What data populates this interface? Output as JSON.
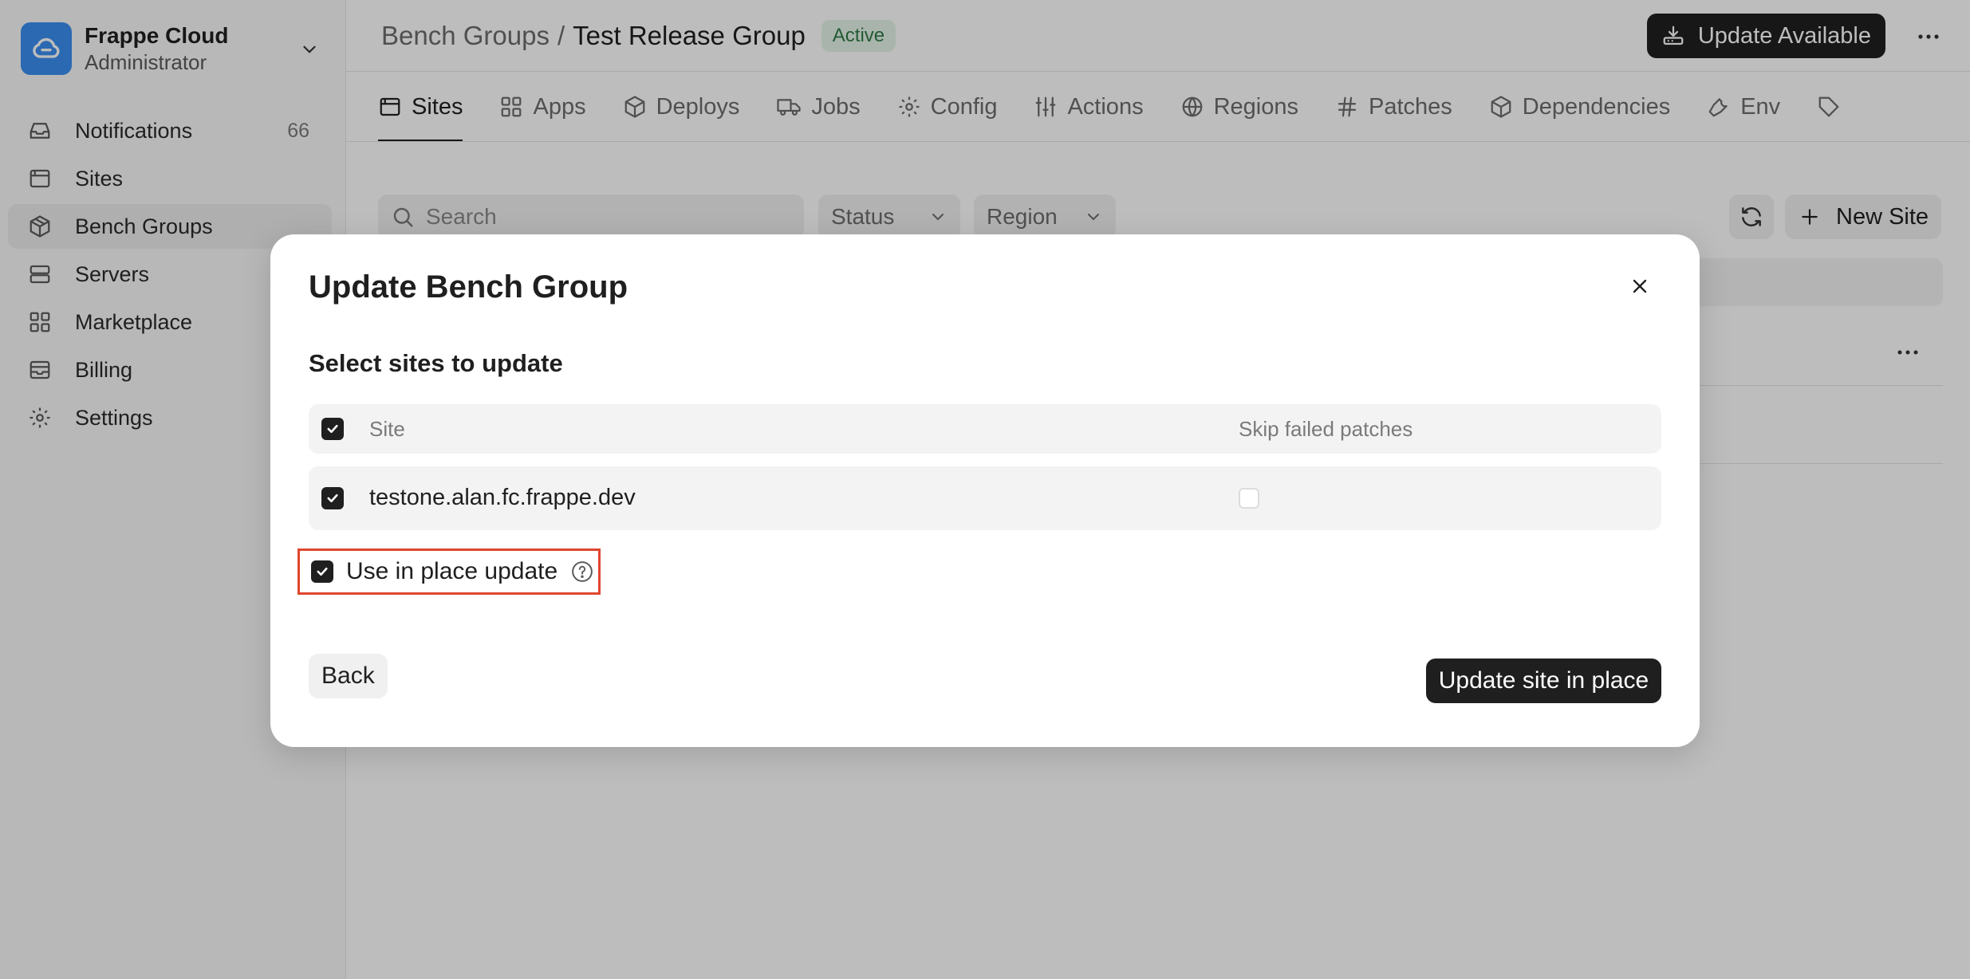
{
  "sidebar": {
    "org_name": "Frappe Cloud",
    "org_role": "Administrator",
    "items": [
      {
        "label": "Notifications",
        "count": "66",
        "icon": "inbox-icon"
      },
      {
        "label": "Sites",
        "icon": "browser-icon"
      },
      {
        "label": "Bench Groups",
        "icon": "package-icon",
        "active": true
      },
      {
        "label": "Servers",
        "icon": "server-icon"
      },
      {
        "label": "Marketplace",
        "icon": "grid-icon"
      },
      {
        "label": "Billing",
        "icon": "wallet-icon"
      },
      {
        "label": "Settings",
        "icon": "gear-icon"
      }
    ]
  },
  "header": {
    "breadcrumb_parent": "Bench Groups",
    "breadcrumb_separator": "/",
    "breadcrumb_current": "Test Release Group",
    "status_badge": "Active",
    "update_button": "Update Available"
  },
  "tabs": [
    {
      "label": "Sites",
      "icon": "browser-icon",
      "active": true
    },
    {
      "label": "Apps",
      "icon": "grid-icon"
    },
    {
      "label": "Deploys",
      "icon": "package-icon"
    },
    {
      "label": "Jobs",
      "icon": "truck-icon"
    },
    {
      "label": "Config",
      "icon": "gear-icon"
    },
    {
      "label": "Actions",
      "icon": "sliders-icon"
    },
    {
      "label": "Regions",
      "icon": "globe-icon"
    },
    {
      "label": "Patches",
      "icon": "hash-icon"
    },
    {
      "label": "Dependencies",
      "icon": "package-icon"
    },
    {
      "label": "Env",
      "icon": "wrench-icon"
    }
  ],
  "toolbar": {
    "search_placeholder": "Search",
    "status_select": "Status",
    "region_select": "Region",
    "new_site_button": "New Site"
  },
  "modal": {
    "title": "Update Bench Group",
    "subtitle": "Select sites to update",
    "table_headers": {
      "site": "Site",
      "skip_failed_patches": "Skip failed patches"
    },
    "rows": [
      {
        "site": "testone.alan.fc.frappe.dev",
        "selected": true,
        "skip_failed_patches": false
      }
    ],
    "in_place_label": "Use in place update",
    "in_place_checked": true,
    "back_button": "Back",
    "primary_button": "Update site in place"
  },
  "colors": {
    "brand": "#3b8ef1",
    "primary_button": "#1f1f1f",
    "highlight_border": "#e0462f",
    "badge_bg": "#e4f5e9",
    "badge_text": "#2f7a45"
  }
}
